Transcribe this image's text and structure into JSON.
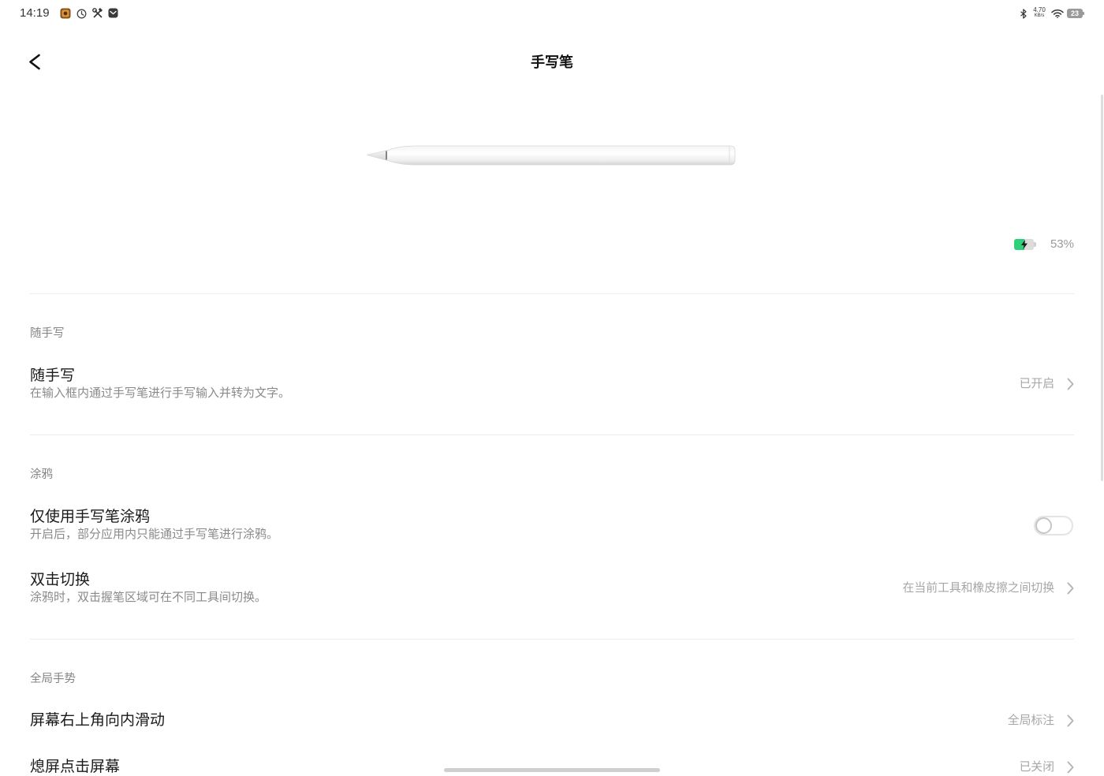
{
  "status_bar": {
    "time": "14:19",
    "notification_icons": [
      "app-icon",
      "clock-icon",
      "tools-icon",
      "mail-icon"
    ],
    "bluetooth_icon": "bluetooth-icon",
    "net_speed": {
      "value": "4.70",
      "unit": "KB/s"
    },
    "wifi_icon": "wifi-icon",
    "battery": {
      "icon": "battery-icon",
      "level": "23"
    }
  },
  "header": {
    "back_icon": "chevron-left-icon",
    "title": "手写笔"
  },
  "stylus": {
    "illustration": "stylus-pen-icon",
    "battery": {
      "icon": "charging-battery-icon",
      "charging": true,
      "level_fraction": 0.53,
      "fill_color": "#2fd07a",
      "label": "53%"
    }
  },
  "sections": [
    {
      "label": "随手写",
      "items": [
        {
          "title": "随手写",
          "subtitle": "在输入框内通过手写笔进行手写输入并转为文字。",
          "value": "已开启",
          "trailing_icon": "chevron-right-icon"
        }
      ]
    },
    {
      "label": "涂鸦",
      "items": [
        {
          "title": "仅使用手写笔涂鸦",
          "subtitle": "开启后，部分应用内只能通过手写笔进行涂鸦。",
          "toggle_on": false
        },
        {
          "title": "双击切换",
          "subtitle": "涂鸦时，双击握笔区域可在不同工具间切换。",
          "value": "在当前工具和橡皮擦之间切换",
          "trailing_icon": "chevron-right-icon"
        }
      ]
    },
    {
      "label": "全局手势",
      "items": [
        {
          "title": "屏幕右上角向内滑动",
          "value": "全局标注",
          "trailing_icon": "chevron-right-icon"
        },
        {
          "title": "熄屏点击屏幕",
          "value": "已关闭",
          "trailing_icon": "chevron-right-icon"
        }
      ]
    }
  ],
  "colors": {
    "accent_green": "#2fd07a",
    "title_text": "#1a1a1a",
    "subtitle_text": "#8a8a8a",
    "value_text": "#a6a6a6"
  }
}
